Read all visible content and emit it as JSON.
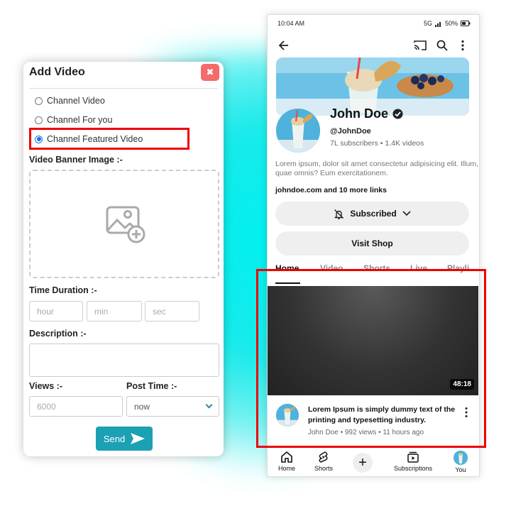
{
  "add_video": {
    "title": "Add Video",
    "close_label": "✖",
    "options": [
      {
        "label": "Channel Video",
        "selected": false
      },
      {
        "label": "Channel For you",
        "selected": false
      },
      {
        "label": "Channel Featured Video",
        "selected": true
      }
    ],
    "banner_label": "Video Banner Image :-",
    "time_label": "Time Duration :-",
    "hour_placeholder": "hour",
    "min_placeholder": "min",
    "sec_placeholder": "sec",
    "description_label": "Description :-",
    "views_label": "Views :-",
    "views_value": "6000",
    "post_time_label": "Post Time :-",
    "post_time_value": "now",
    "send_label": "Send"
  },
  "phone": {
    "status": {
      "time": "10:04 AM",
      "network": "5G",
      "battery": "50%"
    },
    "channel": {
      "name": "John Doe",
      "handle": "@JohnDoe",
      "stats": "7L subscribers • 1.4K videos",
      "description": "Lorem ipsum, dolor sit amet consectetur adipisicing elit. Illum, quae omnis? Eum exercitationem.",
      "links": "johndoe.com and 10 more links",
      "subscribed_label": "Subscribed",
      "visit_shop_label": "Visit Shop"
    },
    "tabs": [
      "Home",
      "Video",
      "Shorts",
      "Live",
      "Playli"
    ],
    "video": {
      "duration": "48:18",
      "title": "Lorem Ipsum is simply dummy text of the printing and typesetting industry.",
      "meta": "John Doe • 992 views • 11 hours ago"
    },
    "nav": {
      "home": "Home",
      "shorts": "Shorts",
      "subscriptions": "Subscriptions",
      "you": "You"
    }
  },
  "colors": {
    "glow": "#00f0f0",
    "highlight": "#ee0000",
    "send": "#1ba1b3",
    "close": "#f36b6b",
    "radio": "#1a73e8"
  }
}
